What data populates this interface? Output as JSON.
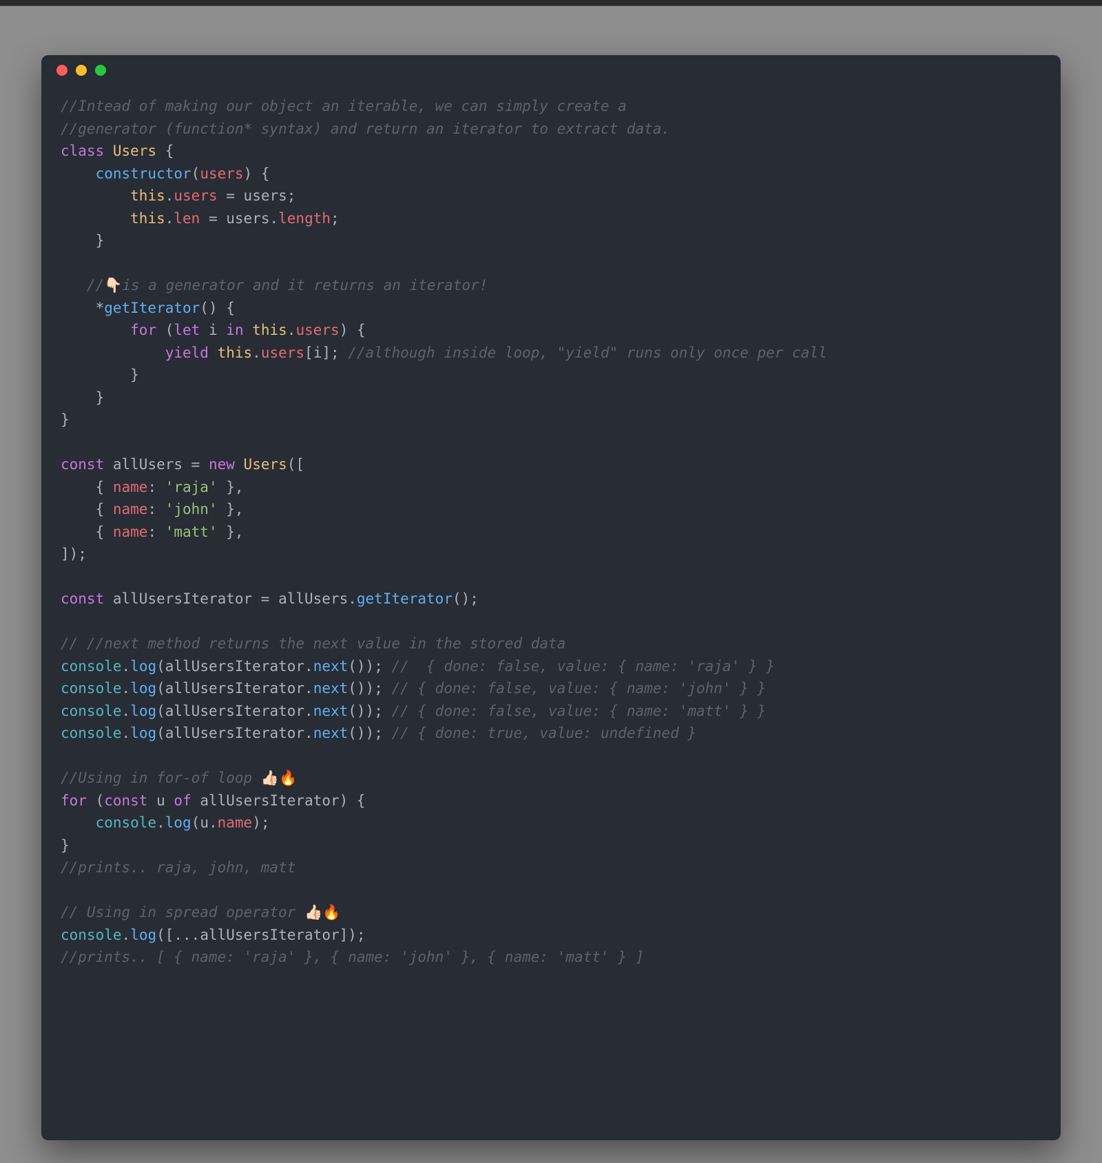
{
  "colors": {
    "background": "#8e8e8e",
    "window": "#282c34",
    "default": "#abb2bf",
    "comment": "#5c6370",
    "keyword": "#c678dd",
    "class": "#e5c07b",
    "ident": "#e06c75",
    "method": "#61afef",
    "string": "#98c379",
    "const": "#56b6c2",
    "dot_red": "#fe5f56",
    "dot_yellow": "#febd2e",
    "dot_green": "#27c93f"
  },
  "code": {
    "l01": "//Intead of making our object an iterable, we can simply create a",
    "l02": "//generator (function* syntax) and return an iterator to extract data.",
    "l03a": "class",
    "l03b": "Users",
    "l03c": "{",
    "l04a": "constructor",
    "l04b": "users",
    "l04c": ") {",
    "l05a": "this",
    "l05b": "users",
    "l05c": "= users;",
    "l06a": "this",
    "l06b": "len",
    "l06c": "= users.",
    "l06d": "length",
    "l06e": ";",
    "l07": "    }",
    "l08": "",
    "l09a": "   //",
    "l09b": "👇🏻",
    "l09c": "is a generator and it returns an iterator!",
    "l10a": "    *",
    "l10b": "getIterator",
    "l10c": "() {",
    "l11a": "for",
    "l11b": "let",
    "l11c": "i",
    "l11d": "in",
    "l11e": "this",
    "l11f": "users",
    "l11g": ") {",
    "l12a": "yield",
    "l12b": "this",
    "l12c": "users",
    "l12d": "[i]; ",
    "l12e": "//although inside loop, \"yield\" runs only once per call",
    "l13": "        }",
    "l14": "    }",
    "l15": "}",
    "l16": "",
    "l17a": "const",
    "l17b": "allUsers = ",
    "l17c": "new",
    "l17d": "Users",
    "l17e": "([",
    "l18a": "name",
    "l18b": "'raja'",
    "l19a": "name",
    "l19b": "'john'",
    "l20a": "name",
    "l20b": "'matt'",
    "l21": "]);",
    "l22": "",
    "l23a": "const",
    "l23b": "allUsersIterator = allUsers.",
    "l23c": "getIterator",
    "l23d": "();",
    "l24": "",
    "l25": "// //next method returns the next value in the stored data",
    "l26a": "console",
    "l26b": "log",
    "l26c": "(allUsersIterator.",
    "l26d": "next",
    "l26e": "()); ",
    "l26f": "//  { done: false, value: { name: 'raja' } }",
    "l27f": "// { done: false, value: { name: 'john' } }",
    "l28f": "// { done: false, value: { name: 'matt' } }",
    "l29f": "// { done: true, value: undefined }",
    "l30": "",
    "l31a": "//Using in for-of loop ",
    "l31b": "👍🏻🔥",
    "l32a": "for",
    "l32b": "const",
    "l32c": "u",
    "l32d": "of",
    "l32e": " allUsersIterator) {",
    "l33a": "console",
    "l33b": "log",
    "l33c": "(u.",
    "l33d": "name",
    "l33e": ");",
    "l34": "}",
    "l35": "//prints.. raja, john, matt",
    "l36": "",
    "l37a": "// Using in spread operator ",
    "l37b": "👍🏻🔥",
    "l38a": "console",
    "l38b": "log",
    "l38c": "([...allUsersIterator]);",
    "l39": "//prints.. [ { name: 'raja' }, { name: 'john' }, { name: 'matt' } ]"
  }
}
